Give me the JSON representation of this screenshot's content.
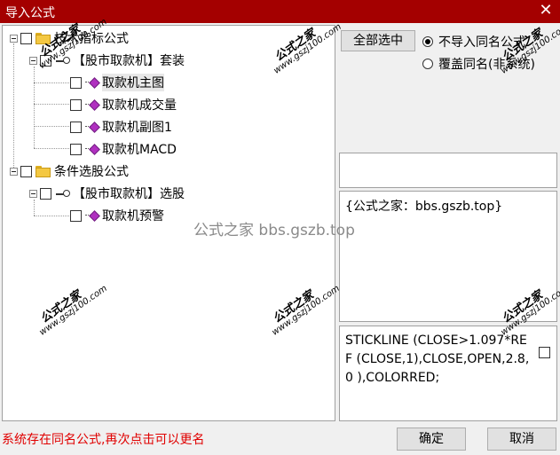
{
  "window": {
    "title": "导入公式",
    "close_glyph": "✕"
  },
  "tree": {
    "groups": [
      {
        "label": "技术指标公式",
        "sub": {
          "label": "【股市取款机】套装",
          "items": [
            "取款机主图",
            "取款机成交量",
            "取款机副图1",
            "取款机MACD"
          ]
        }
      },
      {
        "label": "条件选股公式",
        "sub": {
          "label": "【股市取款机】选股",
          "items": [
            "取款机预警"
          ]
        }
      }
    ]
  },
  "options": {
    "select_all": "全部选中",
    "no_import_same": "不导入同名公式",
    "overwrite_same": "覆盖同名(非系统)"
  },
  "desc_text": "{公式之家：bbs.gszb.top}",
  "code_text": "STICKLINE (CLOSE>1.097*REF (CLOSE,1),CLOSE,OPEN,2.8,0 ),COLORRED;",
  "footer": {
    "message": "系统存在同名公式,再次点击可以更名",
    "ok": "确定",
    "cancel": "取消"
  },
  "watermark": {
    "main": "公式之家",
    "url": "www.gszj100.com",
    "center": "公式之家 bbs.gszb.top"
  }
}
